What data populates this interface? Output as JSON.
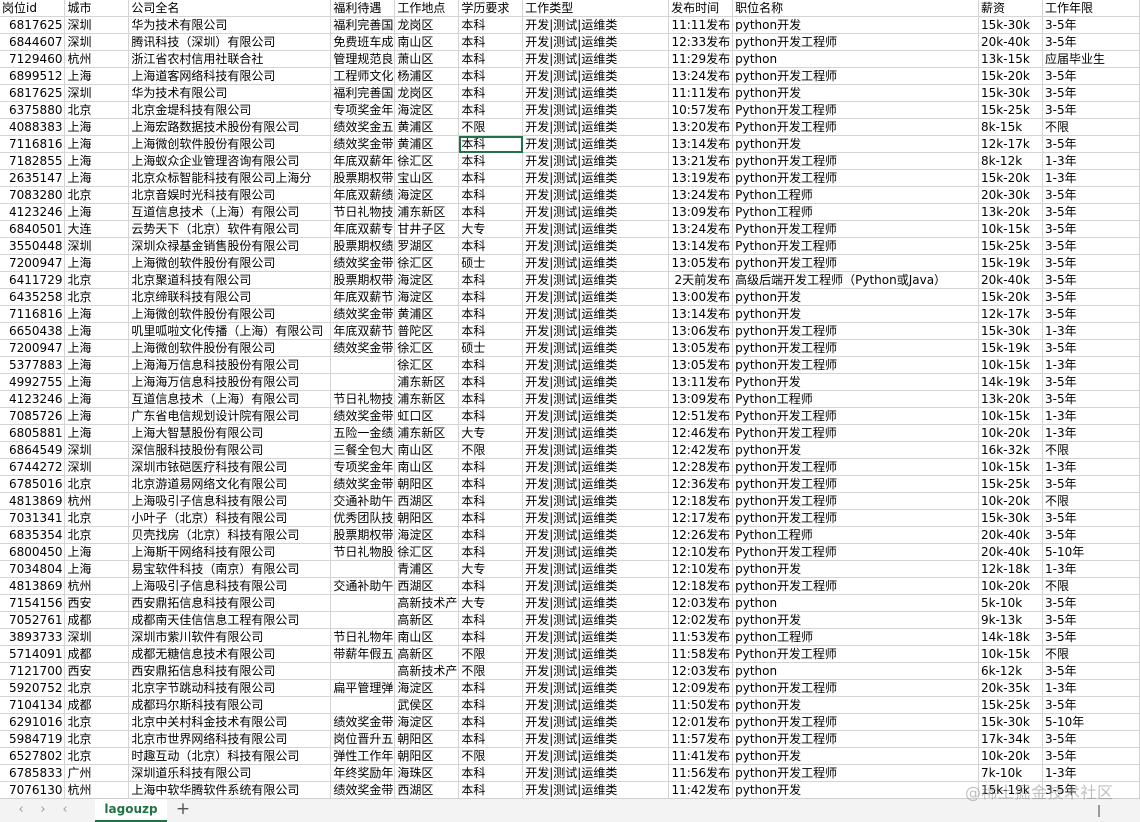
{
  "columns": [
    "岗位id",
    "城市",
    "公司全名",
    "福利待遇",
    "工作地点",
    "学历要求",
    "工作类型",
    "发布时间",
    "职位名称",
    "薪资",
    "工作年限"
  ],
  "rows": [
    [
      "6817625",
      "深圳",
      "华为技术有限公司",
      "福利完善国",
      "龙岗区",
      "本科",
      "开发|测试|运维类",
      "11:11发布",
      "python开发",
      "15k-30k",
      "3-5年"
    ],
    [
      "6844607",
      "深圳",
      "腾讯科技（深圳）有限公司",
      "免费班车成",
      "南山区",
      "本科",
      "开发|测试|运维类",
      "12:33发布",
      "python开发工程师",
      "20k-40k",
      "3-5年"
    ],
    [
      "7129460",
      "杭州",
      "浙江省农村信用社联合社",
      "管理规范良",
      "萧山区",
      "本科",
      "开发|测试|运维类",
      "11:29发布",
      "python",
      "13k-15k",
      "应届毕业生"
    ],
    [
      "6899512",
      "上海",
      "上海道客网络科技有限公司",
      "工程师文化",
      "杨浦区",
      "本科",
      "开发|测试|运维类",
      "13:24发布",
      "python开发工程师",
      "15k-20k",
      "3-5年"
    ],
    [
      "6817625",
      "深圳",
      "华为技术有限公司",
      "福利完善国",
      "龙岗区",
      "本科",
      "开发|测试|运维类",
      "11:11发布",
      "python开发",
      "15k-30k",
      "3-5年"
    ],
    [
      "6375880",
      "北京",
      "北京金堤科技有限公司",
      "专项奖金年",
      "海淀区",
      "本科",
      "开发|测试|运维类",
      "10:57发布",
      "Python开发工程师",
      "15k-25k",
      "3-5年"
    ],
    [
      "4088383",
      "上海",
      "上海宏路数据技术股份有限公司",
      "绩效奖金五",
      "黄浦区",
      "不限",
      "开发|测试|运维类",
      "13:20发布",
      "Python开发工程师",
      "8k-15k",
      "不限"
    ],
    [
      "7116816",
      "上海",
      "上海微创软件股份有限公司",
      "绩效奖金带",
      "黄浦区",
      "本科",
      "开发|测试|运维类",
      "13:14发布",
      "python开发",
      "12k-17k",
      "3-5年"
    ],
    [
      "7182855",
      "上海",
      "上海蚁众企业管理咨询有限公司",
      "年底双薪年",
      "徐汇区",
      "本科",
      "开发|测试|运维类",
      "13:21发布",
      "python开发工程师",
      "8k-12k",
      "1-3年"
    ],
    [
      "2635147",
      "上海",
      "北京众标智能科技有限公司上海分",
      "股票期权带",
      "宝山区",
      "本科",
      "开发|测试|运维类",
      "13:19发布",
      "python开发工程师",
      "15k-20k",
      "1-3年"
    ],
    [
      "7083280",
      "北京",
      "北京音娱时光科技有限公司",
      "年底双薪绩",
      "海淀区",
      "本科",
      "开发|测试|运维类",
      "13:24发布",
      "Python工程师",
      "20k-30k",
      "3-5年"
    ],
    [
      "4123246",
      "上海",
      "互道信息技术（上海）有限公司",
      "节日礼物技",
      "浦东新区",
      "本科",
      "开发|测试|运维类",
      "13:09发布",
      "Python工程师",
      "13k-20k",
      "3-5年"
    ],
    [
      "6840501",
      "大连",
      "云势天下（北京）软件有限公司",
      "年底双薪专",
      "甘井子区",
      "大专",
      "开发|测试|运维类",
      "13:24发布",
      "Python开发工程师",
      "10k-15k",
      "3-5年"
    ],
    [
      "3550448",
      "深圳",
      "深圳众禄基金销售股份有限公司",
      "股票期权绩",
      "罗湖区",
      "本科",
      "开发|测试|运维类",
      "13:14发布",
      "Python开发工程师",
      "15k-25k",
      "3-5年"
    ],
    [
      "7200947",
      "上海",
      "上海微创软件股份有限公司",
      "绩效奖金带",
      "徐汇区",
      "硕士",
      "开发|测试|运维类",
      "13:05发布",
      "python开发工程师",
      "15k-19k",
      "3-5年"
    ],
    [
      "6411729",
      "北京",
      "北京聚道科技有限公司",
      "股票期权带",
      "海淀区",
      "本科",
      "开发|测试|运维类",
      "2天前发布",
      "高级后端开发工程师（Python或Java）",
      "20k-40k",
      "3-5年"
    ],
    [
      "6435258",
      "北京",
      "北京缔联科技有限公司",
      "年底双薪节",
      "海淀区",
      "本科",
      "开发|测试|运维类",
      "13:00发布",
      "python开发",
      "15k-20k",
      "3-5年"
    ],
    [
      "7116816",
      "上海",
      "上海微创软件股份有限公司",
      "绩效奖金带",
      "黄浦区",
      "本科",
      "开发|测试|运维类",
      "13:14发布",
      "python开发",
      "12k-17k",
      "3-5年"
    ],
    [
      "6650438",
      "上海",
      "叽里呱啦文化传播（上海）有限公司",
      "年底双薪节",
      "普陀区",
      "本科",
      "开发|测试|运维类",
      "13:06发布",
      "python开发工程师",
      "15k-30k",
      "1-3年"
    ],
    [
      "7200947",
      "上海",
      "上海微创软件股份有限公司",
      "绩效奖金带",
      "徐汇区",
      "硕士",
      "开发|测试|运维类",
      "13:05发布",
      "python开发工程师",
      "15k-19k",
      "3-5年"
    ],
    [
      "5377883",
      "上海",
      "上海海万信息科技股份有限公司",
      "",
      "徐汇区",
      "本科",
      "开发|测试|运维类",
      "13:05发布",
      "python开发工程师",
      "10k-15k",
      "1-3年"
    ],
    [
      "4992755",
      "上海",
      "上海海万信息科技股份有限公司",
      "",
      "浦东新区",
      "本科",
      "开发|测试|运维类",
      "13:11发布",
      "Python开发",
      "14k-19k",
      "3-5年"
    ],
    [
      "4123246",
      "上海",
      "互道信息技术（上海）有限公司",
      "节日礼物技",
      "浦东新区",
      "本科",
      "开发|测试|运维类",
      "13:09发布",
      "Python工程师",
      "13k-20k",
      "3-5年"
    ],
    [
      "7085726",
      "上海",
      "广东省电信规划设计院有限公司",
      "绩效奖金带",
      "虹口区",
      "本科",
      "开发|测试|运维类",
      "12:51发布",
      "Python开发工程师",
      "10k-15k",
      "1-3年"
    ],
    [
      "6805881",
      "上海",
      "上海大智慧股份有限公司",
      "五险一金绩",
      "浦东新区",
      "大专",
      "开发|测试|运维类",
      "12:46发布",
      "Python开发工程师",
      "10k-20k",
      "1-3年"
    ],
    [
      "6864549",
      "深圳",
      "深信服科技股份有限公司",
      "三餐全包大",
      "南山区",
      "不限",
      "开发|测试|运维类",
      "12:42发布",
      "python开发",
      "16k-32k",
      "不限"
    ],
    [
      "6744272",
      "深圳",
      "深圳市铱硙医疗科技有限公司",
      "专项奖金年",
      "南山区",
      "本科",
      "开发|测试|运维类",
      "12:28发布",
      "python开发工程师",
      "10k-15k",
      "1-3年"
    ],
    [
      "6785016",
      "北京",
      "北京游道易网络文化有限公司",
      "绩效奖金带",
      "朝阳区",
      "本科",
      "开发|测试|运维类",
      "12:36发布",
      "python开发工程师",
      "15k-25k",
      "3-5年"
    ],
    [
      "4813869",
      "杭州",
      "上海吸引子信息科技有限公司",
      "交通补助午",
      "西湖区",
      "本科",
      "开发|测试|运维类",
      "12:18发布",
      "python开发工程师",
      "10k-20k",
      "不限"
    ],
    [
      "7031341",
      "北京",
      "小叶子（北京）科技有限公司",
      "优秀团队技",
      "朝阳区",
      "本科",
      "开发|测试|运维类",
      "12:17发布",
      "python开发工程师",
      "15k-30k",
      "3-5年"
    ],
    [
      "6835354",
      "北京",
      "贝壳找房（北京）科技有限公司",
      "股票期权带",
      "海淀区",
      "本科",
      "开发|测试|运维类",
      "12:26发布",
      "Python工程师",
      "20k-40k",
      "3-5年"
    ],
    [
      "6800450",
      "上海",
      "上海斯干网络科技有限公司",
      "节日礼物股",
      "徐汇区",
      "本科",
      "开发|测试|运维类",
      "12:10发布",
      "Python开发工程师",
      "20k-40k",
      "5-10年"
    ],
    [
      "7034804",
      "上海",
      "易宝软件科技（南京）有限公司",
      "",
      "青浦区",
      "大专",
      "开发|测试|运维类",
      "12:10发布",
      "python开发",
      "12k-18k",
      "1-3年"
    ],
    [
      "4813869",
      "杭州",
      "上海吸引子信息科技有限公司",
      "交通补助午",
      "西湖区",
      "本科",
      "开发|测试|运维类",
      "12:18发布",
      "python开发工程师",
      "10k-20k",
      "不限"
    ],
    [
      "7154156",
      "西安",
      "西安鼎拓信息科技有限公司",
      "",
      "高新技术产",
      "大专",
      "开发|测试|运维类",
      "12:03发布",
      "python",
      "5k-10k",
      "3-5年"
    ],
    [
      "7052761",
      "成都",
      "成都南天佳信信息工程有限公司",
      "",
      "高新区",
      "本科",
      "开发|测试|运维类",
      "12:02发布",
      "python开发",
      "9k-13k",
      "3-5年"
    ],
    [
      "3893733",
      "深圳",
      "深圳市紫川软件有限公司",
      "节日礼物年",
      "南山区",
      "本科",
      "开发|测试|运维类",
      "11:53发布",
      "python工程师",
      "14k-18k",
      "3-5年"
    ],
    [
      "5714091",
      "成都",
      "成都无糖信息技术有限公司",
      "带薪年假五",
      "高新区",
      "不限",
      "开发|测试|运维类",
      "11:58发布",
      "Python开发工程师",
      "10k-15k",
      "不限"
    ],
    [
      "7121700",
      "西安",
      "西安鼎拓信息科技有限公司",
      "",
      "高新技术产",
      "不限",
      "开发|测试|运维类",
      "12:03发布",
      "python",
      "6k-12k",
      "3-5年"
    ],
    [
      "5920752",
      "北京",
      "北京字节跳动科技有限公司",
      "扁平管理弹",
      "海淀区",
      "本科",
      "开发|测试|运维类",
      "12:09发布",
      "python开发工程师",
      "20k-35k",
      "1-3年"
    ],
    [
      "7104134",
      "成都",
      "成都玛尔斯科技有限公司",
      "",
      "武侯区",
      "本科",
      "开发|测试|运维类",
      "11:50发布",
      "python开发",
      "15k-25k",
      "3-5年"
    ],
    [
      "6291016",
      "北京",
      "北京中关村科金技术有限公司",
      "绩效奖金带",
      "海淀区",
      "本科",
      "开发|测试|运维类",
      "12:01发布",
      "python开发工程师",
      "15k-30k",
      "5-10年"
    ],
    [
      "5984719",
      "北京",
      "北京市世界网络科技有限公司",
      "岗位晋升五",
      "朝阳区",
      "本科",
      "开发|测试|运维类",
      "11:57发布",
      "python开发工程师",
      "17k-34k",
      "3-5年"
    ],
    [
      "6527802",
      "北京",
      "时趣互动（北京）科技有限公司",
      "弹性工作年",
      "朝阳区",
      "不限",
      "开发|测试|运维类",
      "11:41发布",
      "python开发",
      "10k-20k",
      "3-5年"
    ],
    [
      "6785833",
      "广州",
      "深圳道乐科技有限公司",
      "年终奖励年",
      "海珠区",
      "本科",
      "开发|测试|运维类",
      "11:56发布",
      "python开发工程师",
      "7k-10k",
      "1-3年"
    ],
    [
      "7076130",
      "杭州",
      "上海中软华腾软件系统有限公司",
      "绩效奖金带",
      "西湖区",
      "本科",
      "开发|测试|运维类",
      "11:42发布",
      "python开发",
      "15k-19k",
      "3-5年"
    ]
  ],
  "sheet_tab": "lagouzp",
  "nav": {
    "prev": "‹",
    "next": "›",
    "add": "+"
  },
  "watermark": "@稀土掘金技术社区"
}
